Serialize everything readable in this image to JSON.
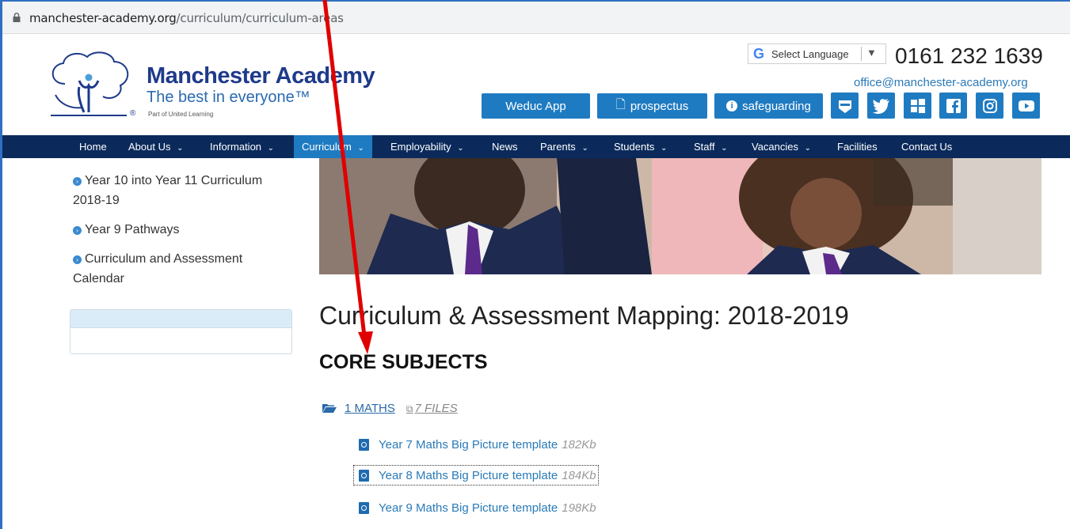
{
  "browser": {
    "url_host": "manchester-academy.org",
    "url_path": "/curriculum/curriculum-areas"
  },
  "logo": {
    "name": "Manchester Academy",
    "tagline": "The best in everyone™",
    "part_of": "Part of United Learning",
    "reg": "®"
  },
  "header": {
    "language_select": "Select Language",
    "phone": "0161 232 1639",
    "email": "office@manchester-academy.org"
  },
  "buttons": [
    {
      "label": "Weduc App",
      "icon": ""
    },
    {
      "label": "prospectus",
      "icon": "pdf-icon"
    },
    {
      "label": "safeguarding",
      "icon": "info-icon"
    }
  ],
  "social_icons": [
    "badge-icon",
    "twitter-icon",
    "windows-icon",
    "facebook-icon",
    "instagram-icon",
    "youtube-icon"
  ],
  "nav": [
    {
      "label": "Home",
      "dropdown": false
    },
    {
      "label": "About Us",
      "dropdown": true
    },
    {
      "label": "Information",
      "dropdown": true
    },
    {
      "label": "Curriculum",
      "dropdown": true,
      "active": true
    },
    {
      "label": "Employability",
      "dropdown": true
    },
    {
      "label": "News",
      "dropdown": false
    },
    {
      "label": "Parents",
      "dropdown": true
    },
    {
      "label": "Students",
      "dropdown": true
    },
    {
      "label": "Staff",
      "dropdown": true
    },
    {
      "label": "Vacancies",
      "dropdown": true
    },
    {
      "label": "Facilities",
      "dropdown": false
    },
    {
      "label": "Contact Us",
      "dropdown": false
    }
  ],
  "sidebar": {
    "links": [
      "Year 10 into Year 11 Curriculum 2018-19",
      "Year 9 Pathways",
      "Curriculum and Assessment Calendar"
    ]
  },
  "main": {
    "title": "Curriculum & Assessment Mapping: 2018-2019",
    "section": "CORE SUBJECTS",
    "folder": {
      "label": "1 MATHS",
      "files_count": "7 FILES"
    },
    "files": [
      {
        "name": "Year 7 Maths Big Picture template",
        "size": "182Kb"
      },
      {
        "name": "Year 8 Maths Big Picture template",
        "size": "184Kb"
      },
      {
        "name": "Year 9 Maths Big Picture template",
        "size": "198Kb"
      }
    ]
  },
  "colors": {
    "nav_bg": "#0b2a5b",
    "accent": "#1f7bc1",
    "link": "#2a7ab8",
    "annotation_arrow": "#e00000"
  }
}
